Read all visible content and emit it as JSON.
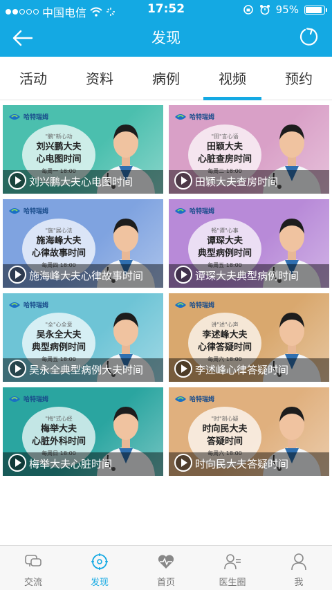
{
  "status_bar": {
    "carrier": "中国电信",
    "time": "17:52",
    "battery_percent": "95%",
    "battery_level": 0.95
  },
  "header": {
    "title": "发现",
    "background_color": "#14a9e3"
  },
  "tabs": [
    {
      "label": "活动"
    },
    {
      "label": "资料"
    },
    {
      "label": "病例"
    },
    {
      "label": "视频",
      "active": true
    },
    {
      "label": "预约"
    }
  ],
  "videos": [
    {
      "caption": "刘兴鹏大夫心电图时间",
      "tag": "\"鹏\"新心动",
      "promo_line1": "刘兴鹏大夫",
      "promo_line2": "心电图时间",
      "promo_time": "每周一 18:00",
      "color": "#4bbfae"
    },
    {
      "caption": "田颖大夫查房时间",
      "tag": "\"田\"言心语",
      "promo_line1": "田颖大夫",
      "promo_line2": "心脏查房时间",
      "promo_time": "每周二 18:00",
      "color": "#d9a0c7"
    },
    {
      "caption": "施海峰大夫心律故事时间",
      "tag": "\"施\"展心法",
      "promo_line1": "施海峰大夫",
      "promo_line2": "心律故事时间",
      "promo_time": "每周四 18:00",
      "color": "#7fa3e0"
    },
    {
      "caption": "谭琛大夫典型病例时间",
      "tag": "畅\"谭\"心事",
      "promo_line1": "谭琛大夫",
      "promo_line2": "典型病例时间",
      "promo_time": "每周五 18:00",
      "color": "#b88ad8"
    },
    {
      "caption": "吴永全典型病例大夫时间",
      "tag": "\"全\"心全意",
      "promo_line1": "吴永全大夫",
      "promo_line2": "典型病例时间",
      "promo_time": "每周五 18:00",
      "color": "#6ec4d6"
    },
    {
      "caption": "李述峰心律答疑时间",
      "tag": "讲\"述\"心声",
      "promo_line1": "李述峰大夫",
      "promo_line2": "心律答疑时间",
      "promo_time": "每周六 18:00",
      "color": "#d9a86e"
    },
    {
      "caption": "梅举大夫心脏时间",
      "tag": "\"梅\"式心经",
      "promo_line1": "梅举大夫",
      "promo_line2": "心脏外科时间",
      "promo_time": "每周日 18:00",
      "color": "#2aa5a0"
    },
    {
      "caption": "时向民大夫答疑时间",
      "tag": "\"时\"刻心疑",
      "promo_line1": "时向民大夫",
      "promo_line2": "答疑时间",
      "promo_time": "每周六 18:00",
      "color": "#e0b07e"
    }
  ],
  "logo_text": "哈特瑞姆",
  "bottom_nav": [
    {
      "label": "交流",
      "icon": "chat-icon"
    },
    {
      "label": "发现",
      "icon": "compass-icon",
      "active": true
    },
    {
      "label": "首页",
      "icon": "heart-pulse-icon"
    },
    {
      "label": "医生圈",
      "icon": "doctor-circle-icon"
    },
    {
      "label": "我",
      "icon": "person-icon"
    }
  ]
}
